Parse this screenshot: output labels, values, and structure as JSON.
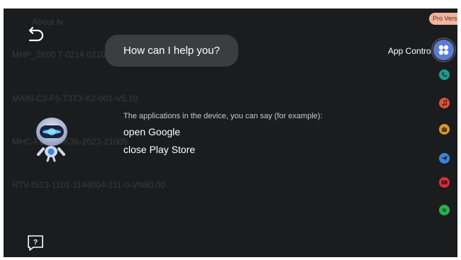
{
  "background": {
    "lines": [
      "About tv",
      "MHP_2K00 T-0214 0210-2021-v0.10",
      "MAIN-C3-F5-T3T3-K2-001-V5.10",
      "MHC-F2-210-K36-2023-21005",
      "RTV-IS13-1101-1144004-211-0-VN80.00"
    ]
  },
  "assistant": {
    "prompt": "How can I help you?",
    "hint": "The applications in the device, you can say (for example):",
    "examples": [
      "open Google",
      "close Play Store"
    ]
  },
  "sidebar": {
    "badge": "Pro Version",
    "app_control_label": "App Control",
    "icons": [
      {
        "name": "phone-icon",
        "color": "#1f9a8a"
      },
      {
        "name": "music-icon",
        "color": "#d9553e"
      },
      {
        "name": "briefcase-icon",
        "color": "#d79a2e"
      },
      {
        "name": "send-icon",
        "color": "#3b86d6"
      },
      {
        "name": "youtube-icon",
        "color": "#d6303a"
      },
      {
        "name": "spotify-icon",
        "color": "#2bb24c"
      }
    ]
  },
  "colors": {
    "accent": "#5b7bd6",
    "badge": "#f0b59f",
    "background": "#1b1c1e",
    "bubble": "#3c3d40"
  }
}
